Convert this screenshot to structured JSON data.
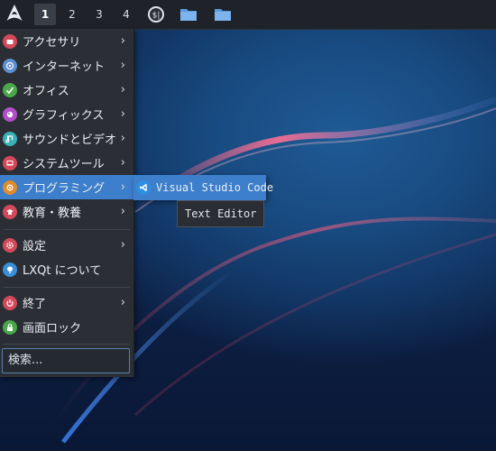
{
  "panel": {
    "start_icon": "arch-logo-icon",
    "workspaces": [
      "1",
      "2",
      "3",
      "4"
    ],
    "active_workspace": "1",
    "tray": [
      {
        "name": "sysmonitor-icon"
      },
      {
        "name": "folder-icon"
      },
      {
        "name": "folder-icon"
      }
    ]
  },
  "menu": {
    "items": [
      {
        "label": "アクセサリ",
        "icon": "accessories-icon",
        "color": "#d2495a",
        "has_submenu": true
      },
      {
        "label": "インターネット",
        "icon": "internet-icon",
        "color": "#5c8fd0",
        "has_submenu": true
      },
      {
        "label": "オフィス",
        "icon": "office-icon",
        "color": "#4aa84a",
        "has_submenu": true
      },
      {
        "label": "グラフィックス",
        "icon": "graphics-icon",
        "color": "#b14fc8",
        "has_submenu": true
      },
      {
        "label": "サウンドとビデオ",
        "icon": "multimedia-icon",
        "color": "#3bb0b8",
        "has_submenu": true
      },
      {
        "label": "システムツール",
        "icon": "system-tools-icon",
        "color": "#d2495a",
        "has_submenu": true
      },
      {
        "label": "プログラミング",
        "icon": "development-icon",
        "color": "#e08a2a",
        "has_submenu": true
      },
      {
        "label": "教育・教養",
        "icon": "education-icon",
        "color": "#d2495a",
        "has_submenu": true
      },
      {
        "label": "設定",
        "icon": "settings-icon",
        "color": "#d2495a",
        "has_submenu": true
      },
      {
        "label": "LXQt について",
        "icon": "about-icon",
        "color": "#3a8fd8",
        "has_submenu": false
      },
      {
        "label": "終了",
        "icon": "power-icon",
        "color": "#d2495a",
        "has_submenu": true
      },
      {
        "label": "画面ロック",
        "icon": "lock-icon",
        "color": "#4aa84a",
        "has_submenu": false
      }
    ],
    "highlighted": "プログラミング",
    "submenu_arrow": "›",
    "search_placeholder": "検索..."
  },
  "submenu": {
    "items": [
      {
        "label": "Visual Studio Code",
        "icon": "vscode-icon",
        "color": "#2f8ee0"
      }
    ],
    "tooltip": "Text Editor"
  },
  "colors": {
    "panel_bg": "#1f2329",
    "menu_bg": "#2b2f35",
    "highlight": "#3d7fcb"
  }
}
